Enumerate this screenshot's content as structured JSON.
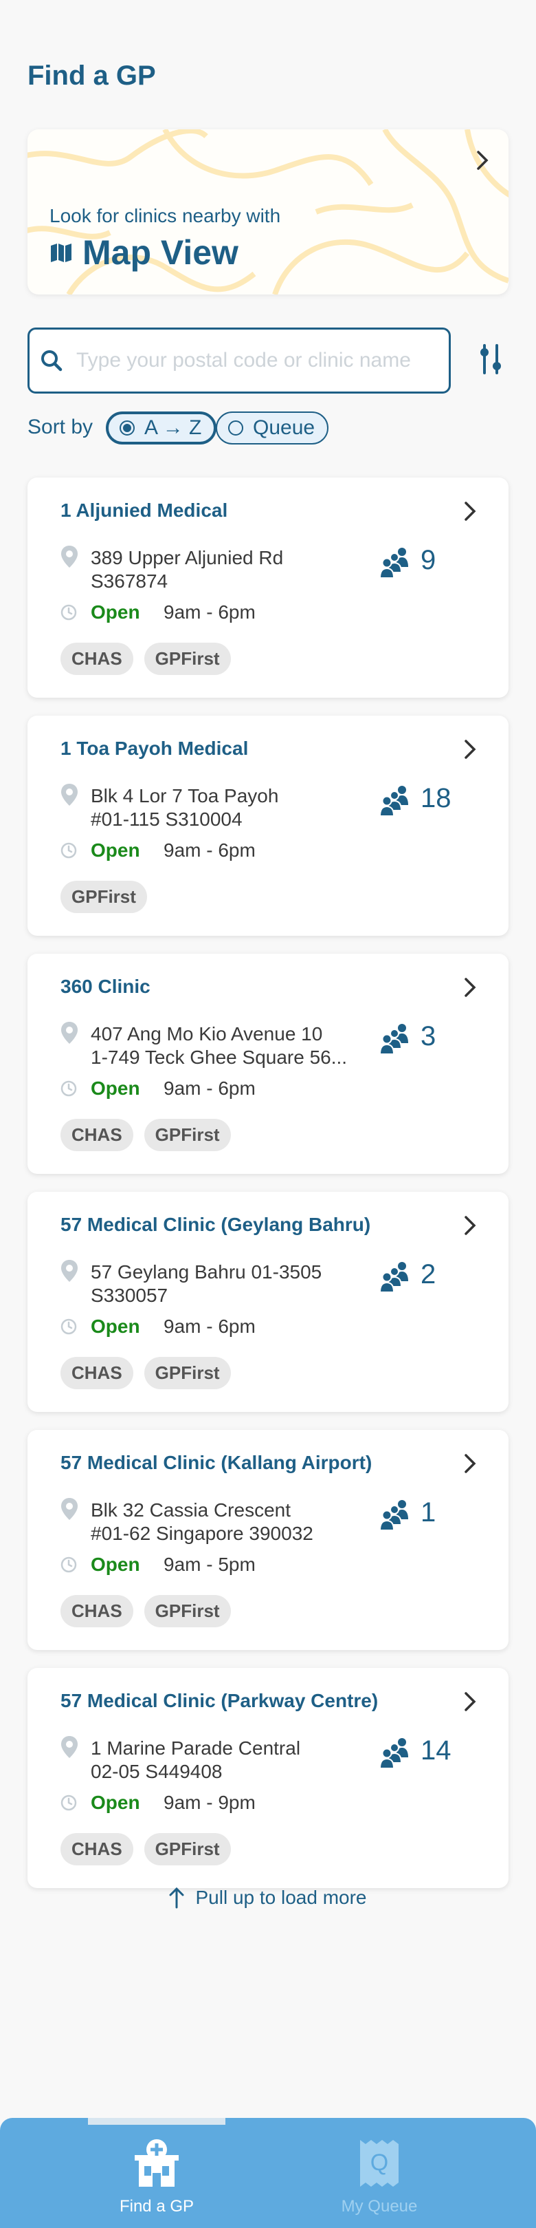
{
  "page": {
    "title": "Find a GP"
  },
  "map_card": {
    "subtitle": "Look for clinics nearby with",
    "title": "Map View"
  },
  "search": {
    "placeholder": "Type your postal code or clinic name",
    "value": ""
  },
  "sort": {
    "label": "Sort by",
    "options": [
      {
        "label": "A → Z",
        "selected": true
      },
      {
        "label": "Queue",
        "selected": false
      }
    ]
  },
  "clinics": [
    {
      "name": "1 Aljunied Medical",
      "address_line1": "389 Upper Aljunied Rd",
      "address_line2": "S367874",
      "queue": "9",
      "status": "Open",
      "hours": "9am - 6pm",
      "tags": [
        "CHAS",
        "GPFirst"
      ]
    },
    {
      "name": "1 Toa Payoh Medical",
      "address_line1": "Blk 4 Lor 7 Toa Payoh",
      "address_line2": "#01-115 S310004",
      "queue": "18",
      "status": "Open",
      "hours": "9am - 6pm",
      "tags": [
        "GPFirst"
      ]
    },
    {
      "name": "360 Clinic",
      "address_line1": "407 Ang Mo Kio Avenue 10",
      "address_line2": "1-749 Teck Ghee Square 56...",
      "queue": "3",
      "status": "Open",
      "hours": "9am - 6pm",
      "tags": [
        "CHAS",
        "GPFirst"
      ]
    },
    {
      "name": "57 Medical Clinic (Geylang Bahru)",
      "address_line1": "57 Geylang Bahru 01-3505",
      "address_line2": "S330057",
      "queue": "2",
      "status": "Open",
      "hours": "9am - 6pm",
      "tags": [
        "CHAS",
        "GPFirst"
      ]
    },
    {
      "name": "57 Medical Clinic (Kallang Airport)",
      "address_line1": "Blk 32 Cassia Crescent",
      "address_line2": "#01-62 Singapore 390032",
      "queue": "1",
      "status": "Open",
      "hours": "9am - 5pm",
      "tags": [
        "CHAS",
        "GPFirst"
      ]
    },
    {
      "name": "57 Medical Clinic (Parkway Centre)",
      "address_line1": "1 Marine Parade Central",
      "address_line2": "02-05 S449408",
      "queue": "14",
      "status": "Open",
      "hours": "9am - 9pm",
      "tags": [
        "CHAS",
        "GPFirst"
      ]
    }
  ],
  "load_more": "Pull up to load more",
  "tabs": [
    {
      "label": "Find a GP",
      "icon": "clinic-icon",
      "active": true
    },
    {
      "label": "My Queue",
      "icon": "queue-ticket-icon",
      "active": false
    }
  ],
  "colors": {
    "primary": "#1e5f86",
    "open": "#1a8a1a",
    "tabbar": "#5eaadf",
    "map_roads": "#fde9b8"
  }
}
